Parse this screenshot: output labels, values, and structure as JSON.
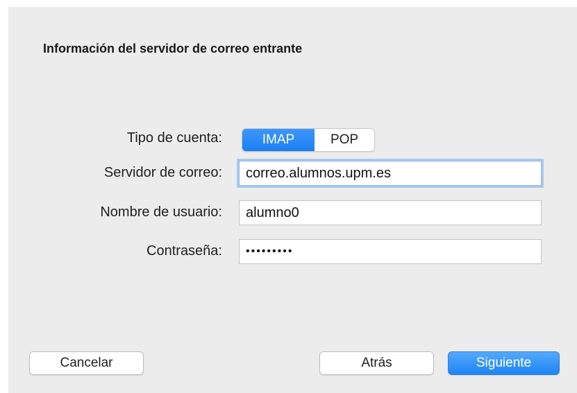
{
  "dialog": {
    "title": "Información del servidor de correo entrante"
  },
  "form": {
    "account_type": {
      "label": "Tipo de cuenta:",
      "options": [
        "IMAP",
        "POP"
      ],
      "selected": "IMAP"
    },
    "mail_server": {
      "label": "Servidor de correo:",
      "value": "correo.alumnos.upm.es"
    },
    "username": {
      "label": "Nombre de usuario:",
      "value": "alumno0"
    },
    "password": {
      "label": "Contraseña:",
      "value": "•••••••••"
    }
  },
  "buttons": {
    "cancel": "Cancelar",
    "back": "Atrás",
    "next": "Siguiente"
  },
  "colors": {
    "accent": "#1b7ff2",
    "background": "#ececec"
  }
}
